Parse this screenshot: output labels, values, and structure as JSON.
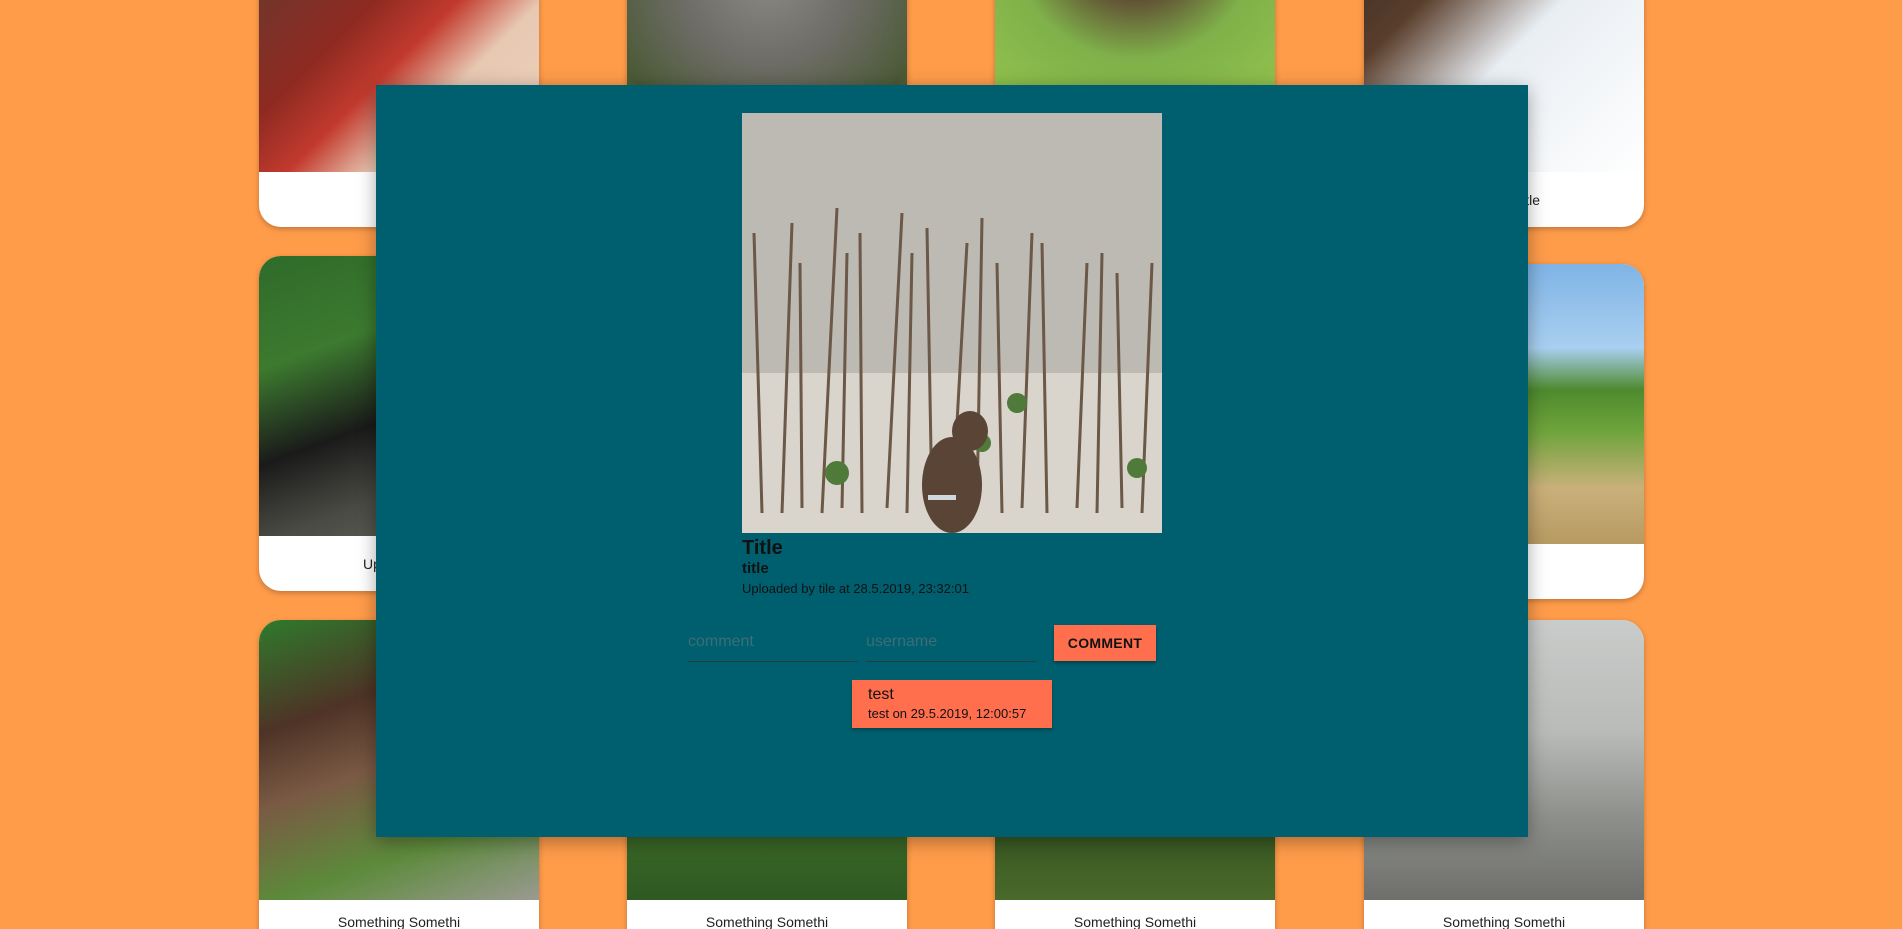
{
  "colors": {
    "background": "#ff9c4a",
    "modal": "#005f6e",
    "accent": "#ff6f4e"
  },
  "gallery": {
    "captions": {
      "card_r1c4_partial": "tle",
      "card_r2c1_partial": "Up",
      "card_r3c1": "Something Somethi",
      "card_r3c2": "Something Somethi",
      "card_r3c3": "Something Somethi",
      "card_r3c4": "Something Somethi"
    }
  },
  "modal": {
    "post": {
      "title": "Title",
      "subtitle": "title",
      "uploaded": "Uploaded by tile at 28.5.2019, 23:32:01"
    },
    "form": {
      "comment_placeholder": "comment",
      "username_placeholder": "username",
      "submit_label": "COMMENT"
    },
    "comments": [
      {
        "text": "test",
        "meta": "test on 29.5.2019, 12:00:57"
      }
    ]
  }
}
